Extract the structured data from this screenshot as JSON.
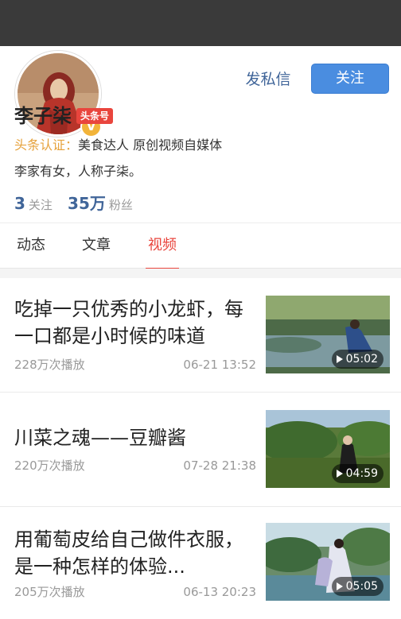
{
  "profile": {
    "name": "李子柒",
    "badge": "头条号",
    "dm_label": "发私信",
    "follow_label": "关注",
    "verified_mark": "V",
    "cert_label": "头条认证：",
    "cert_text": "美食达人 原创视频自媒体",
    "bio": "李家有女，人称子柒。",
    "following_count": "3",
    "following_label": "关注",
    "fans_count": "35万",
    "fans_label": "粉丝"
  },
  "tabs": [
    {
      "label": "动态",
      "active": false
    },
    {
      "label": "文章",
      "active": false
    },
    {
      "label": "视频",
      "active": true
    }
  ],
  "videos": [
    {
      "title": "吃掉一只优秀的小龙虾，每一口都是小时候的味道",
      "views": "228万次播放",
      "date": "06-21 13:52",
      "duration": "05:02"
    },
    {
      "title": "川菜之魂——豆瓣酱",
      "views": "220万次播放",
      "date": "07-28 21:38",
      "duration": "04:59"
    },
    {
      "title": "用葡萄皮给自己做件衣服，是一种怎样的体验...",
      "views": "205万次播放",
      "date": "06-13 20:23",
      "duration": "05:05"
    }
  ],
  "colors": {
    "accent_red": "#e9453d",
    "link_blue": "#406599",
    "button_blue": "#4a8de0",
    "cert_orange": "#e6a23c"
  }
}
